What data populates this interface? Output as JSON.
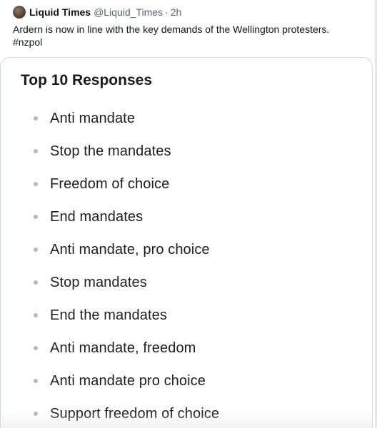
{
  "tweet": {
    "author_name": "Liquid Times",
    "handle": "@Liquid_Times",
    "separator": "·",
    "timestamp": "2h",
    "text_line1": "Ardern is now in line with the key demands of the Wellington protesters.",
    "text_line2": "#nzpol"
  },
  "card": {
    "title": "Top 10 Responses",
    "responses": [
      "Anti mandate",
      "Stop the mandates",
      "Freedom of choice",
      "End mandates",
      "Anti mandate, pro choice",
      "Stop mandates",
      "End the mandates",
      "Anti mandate, freedom",
      "Anti mandate pro choice",
      "Support freedom of choice"
    ]
  }
}
